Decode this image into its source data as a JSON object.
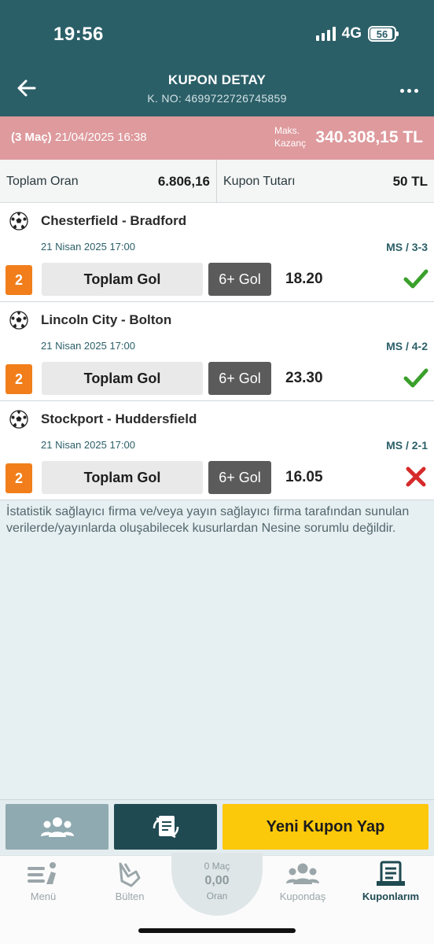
{
  "status": {
    "time": "19:56",
    "network": "4G",
    "battery": "56"
  },
  "nav": {
    "title": "KUPON DETAY",
    "subtitle": "K. NO: 4699722726745859"
  },
  "coupon": {
    "match_count": "(3 Maç)",
    "datetime": "21/04/2025 16:38",
    "max_label_1": "Maks.",
    "max_label_2": "Kazanç",
    "max_win": "340.308,15 TL"
  },
  "summary": {
    "total_odds_label": "Toplam Oran",
    "total_odds": "6.806,16",
    "amount_label": "Kupon Tutarı",
    "amount": "50 TL"
  },
  "matches": [
    {
      "teams": "Chesterfield - Bradford",
      "date": "21 Nisan 2025 17:00",
      "score": "MS / 3-3",
      "number": "2",
      "market": "Toplam Gol",
      "selection": "6+ Gol",
      "odd": "18.20",
      "result": "won"
    },
    {
      "teams": "Lincoln City - Bolton",
      "date": "21 Nisan 2025 17:00",
      "score": "MS / 4-2",
      "number": "2",
      "market": "Toplam Gol",
      "selection": "6+ Gol",
      "odd": "23.30",
      "result": "won"
    },
    {
      "teams": "Stockport - Huddersfield",
      "date": "21 Nisan 2025 17:00",
      "score": "MS / 2-1",
      "number": "2",
      "market": "Toplam Gol",
      "selection": "6+ Gol",
      "odd": "16.05",
      "result": "lost"
    }
  ],
  "disclaimer": "İstatistik sağlayıcı firma ve/veya yayın sağlayıcı firma tarafından sunulan verilerde/yayınlarda oluşabilecek kusurlardan Nesine sorumlu değildir.",
  "actions": {
    "new_coupon": "Yeni Kupon Yap"
  },
  "tabs": {
    "menu": "Menü",
    "bulletin": "Bülten",
    "center_matches": "0 Maç",
    "center_odds": "0,00",
    "center_label": "Oran",
    "kupondas": "Kupondaş",
    "kuponlarim": "Kuponlarım"
  },
  "colors": {
    "header": "#2b5f68",
    "pink": "#de9a9d",
    "orange": "#f17e1b",
    "yellow": "#fcc80a",
    "win": "#3aa02b",
    "loss": "#d62b2b"
  }
}
